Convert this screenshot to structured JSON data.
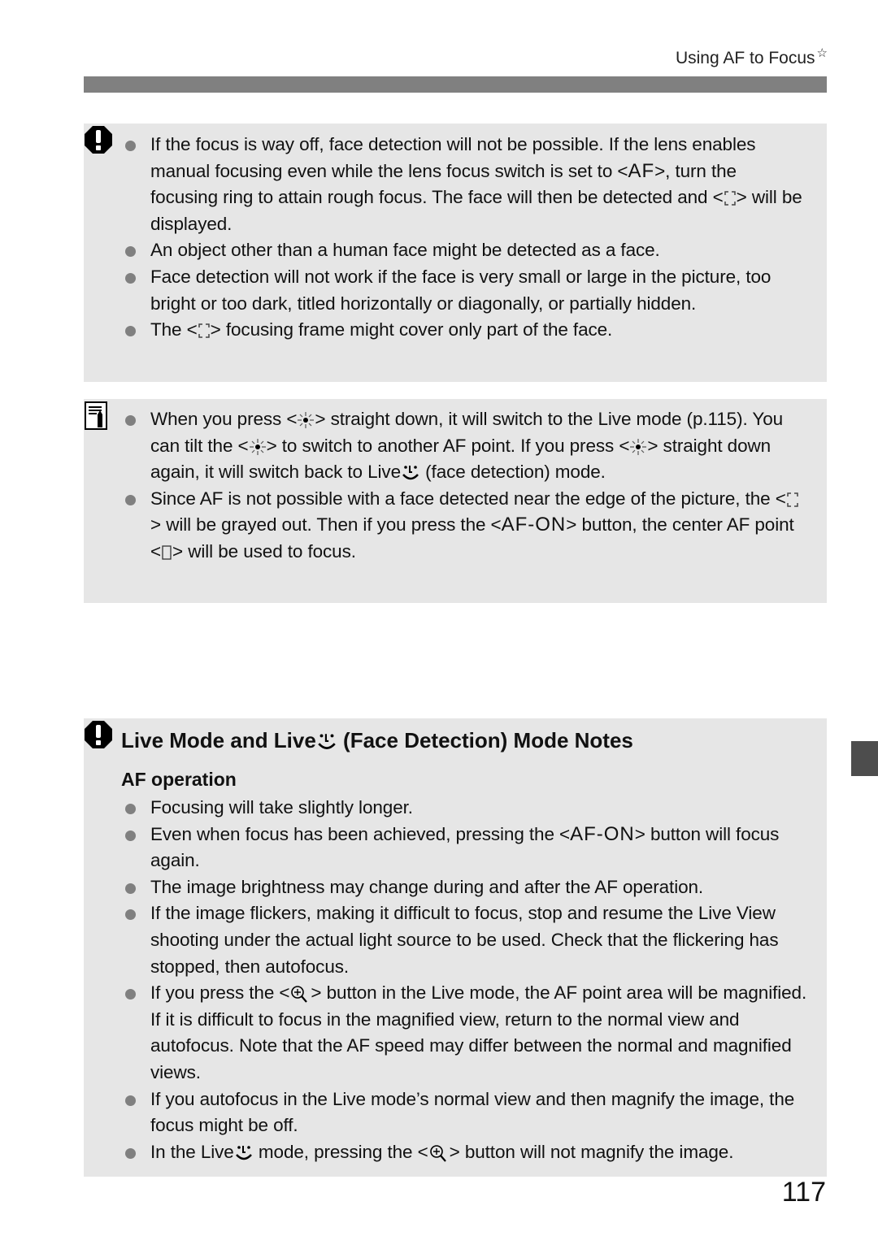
{
  "header": {
    "section_title": "Using AF to Focus",
    "star_glyph": "☆"
  },
  "caution_box_1": {
    "icon": "caution-icon",
    "items": [
      {
        "parts": [
          "If the focus is way off, face detection will not be possible. If the lens enables manual focusing even while the lens focus switch is set to ",
          "<",
          "AF",
          ">, turn the focusing ring to attain rough focus. The face will then be detected and <",
          "> will be displayed."
        ]
      },
      {
        "text": "An object other than a human face might be detected as a face."
      },
      {
        "text": "Face detection will not work if the face is very small or large in the picture, too bright or too dark, titled horizontally or diagonally, or partially hidden."
      },
      {
        "parts": [
          "The <",
          "> focusing frame might cover only part of the face."
        ]
      }
    ]
  },
  "note_box": {
    "icon": "note-pencil-icon",
    "items": [
      {
        "parts": [
          "When you press <",
          "> straight down, it will switch to the Live mode (p.115). You can tilt the <",
          "> to switch to another AF point. If you press <",
          "> straight down again, it will switch back to Live",
          " (face detection) mode."
        ]
      },
      {
        "parts": [
          "Since AF is not possible with a face detected near the edge of the picture, the <",
          "> will be grayed out. Then if you press the <",
          "AF-ON",
          "> button, the center AF point <",
          "> will be used to focus."
        ]
      }
    ]
  },
  "caution_box_2": {
    "icon": "caution-icon",
    "title_parts": [
      "Live Mode and Live",
      " (Face Detection) Mode Notes"
    ],
    "subheading": "AF operation",
    "items": [
      {
        "text": "Focusing will take slightly longer."
      },
      {
        "parts": [
          "Even when focus has been achieved, pressing the <",
          "AF-ON",
          "> button will focus again."
        ]
      },
      {
        "text": "The image brightness may change during and after the AF operation."
      },
      {
        "text": "If the image flickers, making it difficult to focus, stop and resume the Live View shooting under the actual light source to be used. Check that the flickering has stopped, then autofocus."
      },
      {
        "parts": [
          "If you press the <",
          "> button in the Live mode, the AF point area will be magnified. If it is difficult to focus in the magnified view, return to the normal view and autofocus. Note that the AF speed may differ between the normal and magnified views."
        ]
      },
      {
        "text": "If you autofocus in the Live mode’s normal view and then magnify the image, the focus might be off."
      },
      {
        "parts": [
          "In the Live",
          " mode, pressing the <",
          "> button will not magnify the image."
        ]
      }
    ]
  },
  "footer": {
    "page_number": "117"
  },
  "colors": {
    "box_background": "#e6e6e6",
    "header_bar": "#808080",
    "bullet": "#808080",
    "thumb_tab": "#4d4d4d"
  }
}
